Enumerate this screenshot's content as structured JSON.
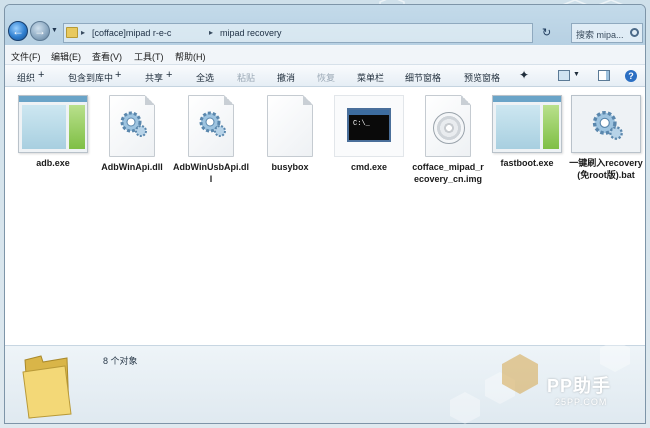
{
  "address_bar": {
    "breadcrumbs": [
      "[cofface]mipad r-e-c",
      "mipad recovery"
    ],
    "search_placeholder": "搜索 mipa..."
  },
  "menu": {
    "items": [
      "文件(F)",
      "编辑(E)",
      "查看(V)",
      "工具(T)",
      "帮助(H)"
    ]
  },
  "toolbar": {
    "organize": "组织",
    "include_library": "包含到库中",
    "share": "共享",
    "select_all": "全选",
    "paste": "粘贴",
    "undo": "撤消",
    "redo": "恢复",
    "menubar": "菜单栏",
    "details_pane": "细节窗格",
    "preview_pane": "预览窗格"
  },
  "files": [
    {
      "name": "adb.exe",
      "icon": "exe-window-icon"
    },
    {
      "name": "AdbWinApi.dll",
      "icon": "dll-gear-icon"
    },
    {
      "name": "AdbWinUsbApi.dll",
      "icon": "dll-gear-icon"
    },
    {
      "name": "busybox",
      "icon": "blank-file-icon"
    },
    {
      "name": "cmd.exe",
      "icon": "cmd-window-icon"
    },
    {
      "name": "cofface_mipad_recovery_cn.img",
      "icon": "disc-image-icon"
    },
    {
      "name": "fastboot.exe",
      "icon": "exe-window-icon"
    },
    {
      "name": "一键刷入recovery(免root版).bat",
      "icon": "batch-gear-icon"
    }
  ],
  "details": {
    "item_count": "8 个对象"
  },
  "watermark": {
    "brand": "PP助手",
    "site": "25PP.COM"
  }
}
